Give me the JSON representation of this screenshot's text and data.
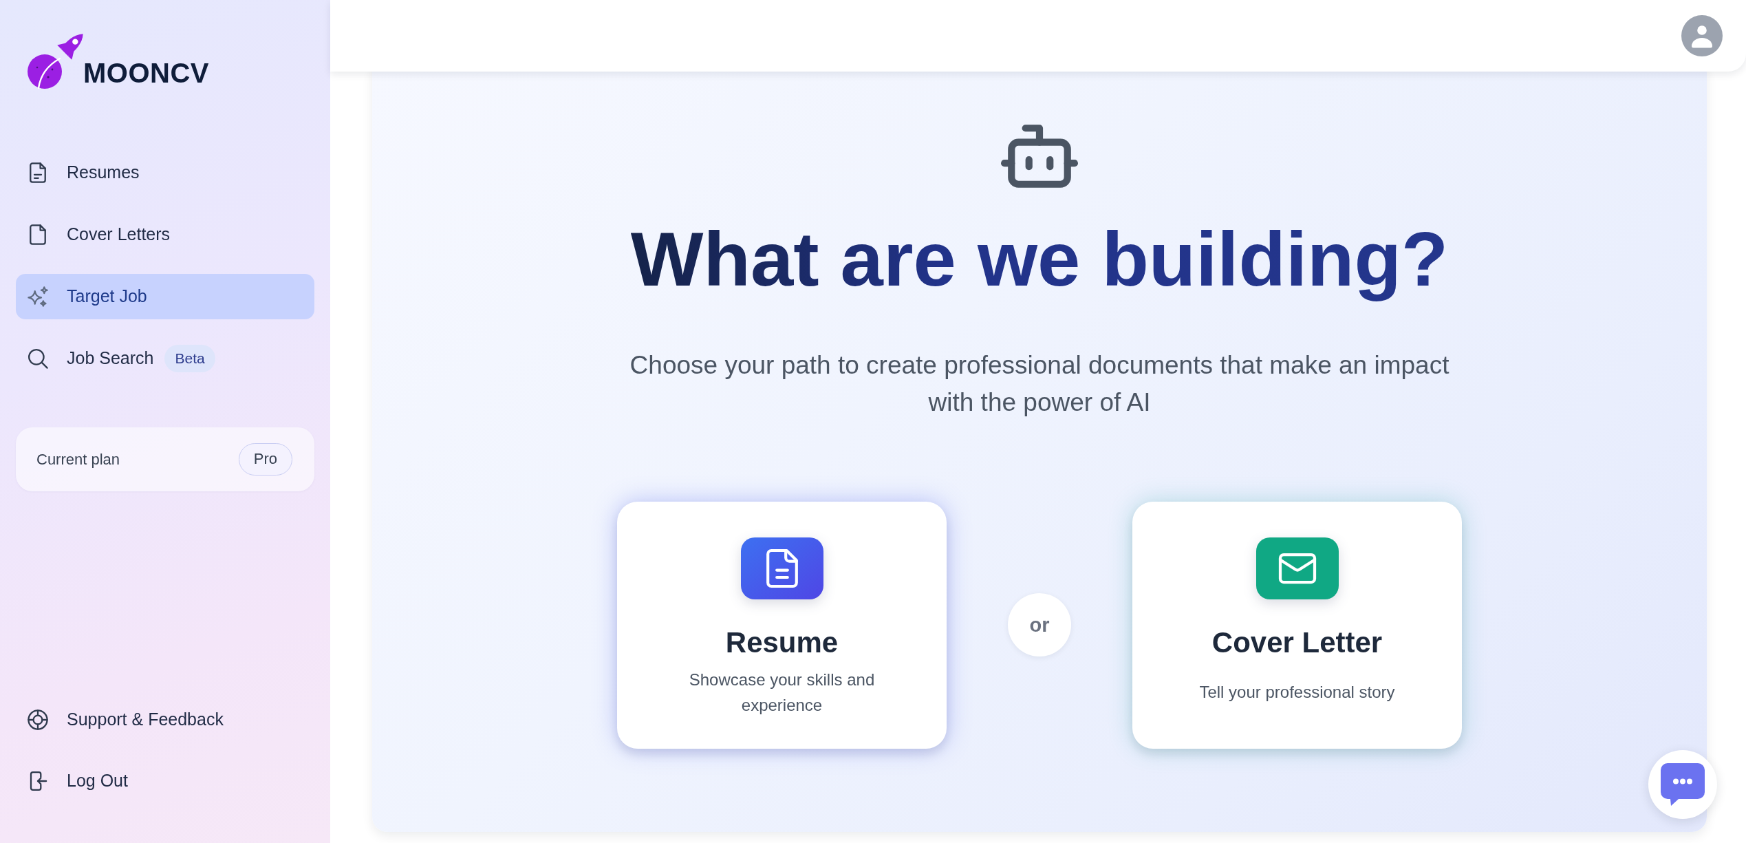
{
  "sidebar": {
    "logo": {
      "text": "MOONCV"
    },
    "nav_items": [
      {
        "label": "Resumes",
        "selected": false
      },
      {
        "label": "Cover Letters",
        "selected": false
      },
      {
        "label": "Target Job",
        "selected": true
      },
      {
        "label": "Job Search",
        "selected": false,
        "badge": "Beta"
      }
    ],
    "plan": {
      "label": "Current plan",
      "value": "Pro"
    },
    "footer_items": [
      {
        "label": "Support & Feedback"
      },
      {
        "label": "Log Out"
      }
    ]
  },
  "hero": {
    "title": "What are we building?",
    "subtitle": "Choose your path to create professional documents that make an impact with the power of AI"
  },
  "options": [
    {
      "title": "Resume",
      "description": "Showcase your skills and experience"
    },
    {
      "title": "Cover Letter",
      "description": "Tell your professional story"
    }
  ],
  "separator": "or"
}
